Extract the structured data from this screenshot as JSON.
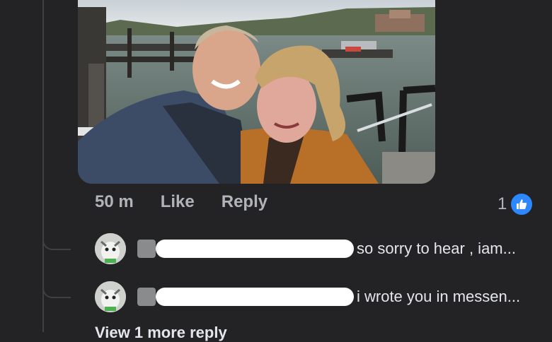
{
  "comment": {
    "timestamp": "50 m",
    "like_label": "Like",
    "reply_label": "Reply",
    "like_count": "1"
  },
  "replies": [
    {
      "author": "[redacted]",
      "text": "so sorry to hear , iam..."
    },
    {
      "author": "[redacted]",
      "text": "i wrote you in messen..."
    }
  ],
  "view_more": "View 1 more reply",
  "colors": {
    "background": "#232325",
    "text": "#e4e6eb",
    "muted": "#b0b3b8",
    "like_badge": "#2d88ff"
  },
  "icons": [
    "thumbs-up-icon"
  ]
}
